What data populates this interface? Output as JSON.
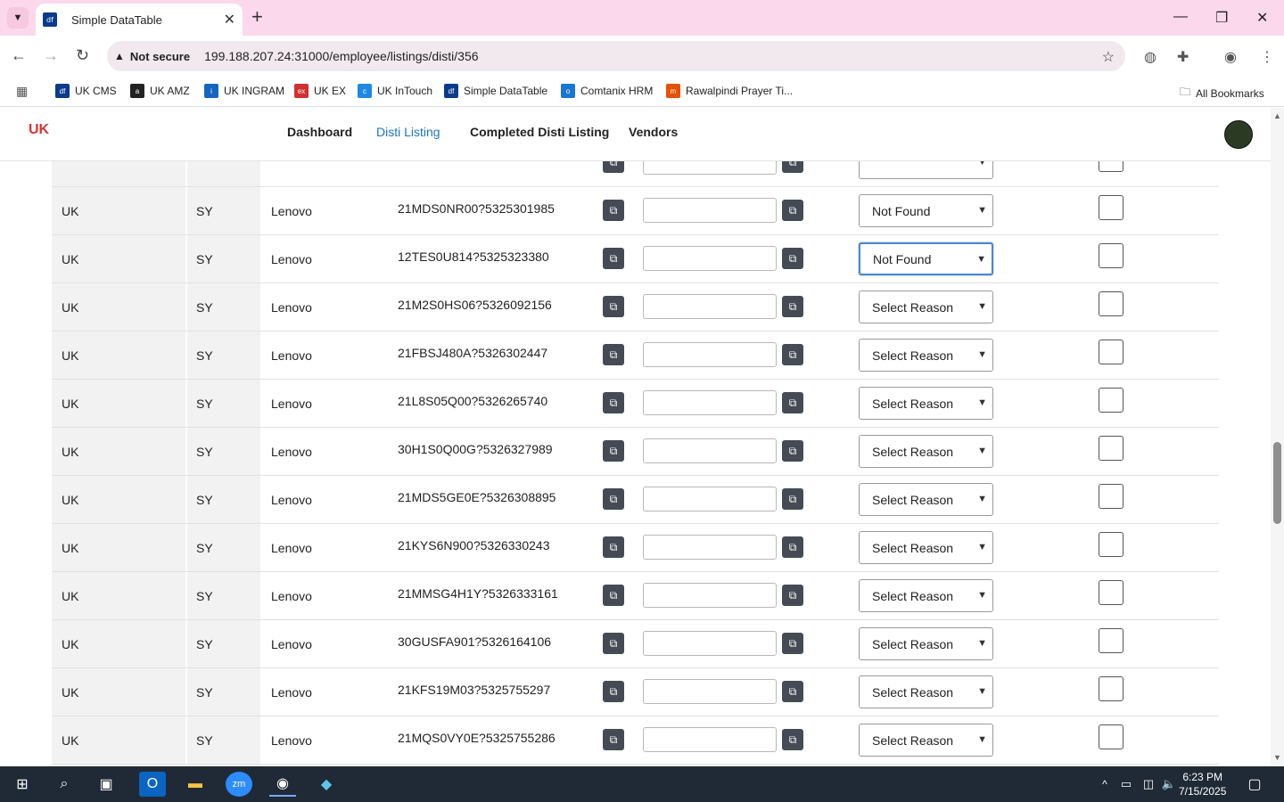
{
  "browser": {
    "tab_title": "Simple DataTable",
    "tab_favicon_text": "df",
    "security_label": "Not secure",
    "url": "199.188.207.24:31000/employee/listings/disti/356",
    "bookmarks": [
      {
        "label": "UK CMS",
        "color": "#0b3b8c",
        "icon": "df"
      },
      {
        "label": "UK AMZ",
        "color": "#222222",
        "icon": "a"
      },
      {
        "label": "UK INGRAM",
        "color": "#1565c0",
        "icon": "i"
      },
      {
        "label": "UK EX",
        "color": "#d32f2f",
        "icon": "ex"
      },
      {
        "label": "UK InTouch",
        "color": "#1e88e5",
        "icon": "c"
      },
      {
        "label": "Simple DataTable",
        "color": "#0b3b8c",
        "icon": "df"
      },
      {
        "label": "Comtanix HRM",
        "color": "#1976d2",
        "icon": "o"
      },
      {
        "label": "Rawalpindi Prayer Ti...",
        "color": "#e65100",
        "icon": "m"
      }
    ],
    "all_bookmarks_label": "All Bookmarks"
  },
  "app": {
    "logo_text": "UK",
    "nav": [
      {
        "label": "Dashboard",
        "active": false
      },
      {
        "label": "Disti Listing",
        "active": true
      },
      {
        "label": "Completed Disti Listing",
        "active": false
      },
      {
        "label": "Vendors",
        "active": false
      }
    ]
  },
  "table": {
    "rows": [
      {
        "country": "",
        "code": "",
        "brand": "",
        "sku": "",
        "reason": "",
        "partial": true
      },
      {
        "country": "UK",
        "code": "SY",
        "brand": "Lenovo",
        "sku": "21MDS0NR00?5325301985",
        "reason": "Not Found"
      },
      {
        "country": "UK",
        "code": "SY",
        "brand": "Lenovo",
        "sku": "12TES0U814?5325323380",
        "reason": "Not Found",
        "focused": true
      },
      {
        "country": "UK",
        "code": "SY",
        "brand": "Lenovo",
        "sku": "21M2S0HS06?5326092156",
        "reason": "Select Reason"
      },
      {
        "country": "UK",
        "code": "SY",
        "brand": "Lenovo",
        "sku": "21FBSJ480A?5326302447",
        "reason": "Select Reason"
      },
      {
        "country": "UK",
        "code": "SY",
        "brand": "Lenovo",
        "sku": "21L8S05Q00?5326265740",
        "reason": "Select Reason"
      },
      {
        "country": "UK",
        "code": "SY",
        "brand": "Lenovo",
        "sku": "30H1S0Q00G?5326327989",
        "reason": "Select Reason"
      },
      {
        "country": "UK",
        "code": "SY",
        "brand": "Lenovo",
        "sku": "21MDS5GE0E?5326308895",
        "reason": "Select Reason"
      },
      {
        "country": "UK",
        "code": "SY",
        "brand": "Lenovo",
        "sku": "21KYS6N900?5326330243",
        "reason": "Select Reason"
      },
      {
        "country": "UK",
        "code": "SY",
        "brand": "Lenovo",
        "sku": "21MMSG4H1Y?5326333161",
        "reason": "Select Reason"
      },
      {
        "country": "UK",
        "code": "SY",
        "brand": "Lenovo",
        "sku": "30GUSFA901?5326164106",
        "reason": "Select Reason"
      },
      {
        "country": "UK",
        "code": "SY",
        "brand": "Lenovo",
        "sku": "21KFS19M03?5325755297",
        "reason": "Select Reason"
      },
      {
        "country": "UK",
        "code": "SY",
        "brand": "Lenovo",
        "sku": "21MQS0VY0E?5325755286",
        "reason": "Select Reason"
      },
      {
        "country": "",
        "code": "",
        "brand": "",
        "sku": "",
        "reason": "",
        "partial": true
      }
    ]
  },
  "taskbar": {
    "time": "6:23 PM",
    "date": "7/15/2025"
  }
}
